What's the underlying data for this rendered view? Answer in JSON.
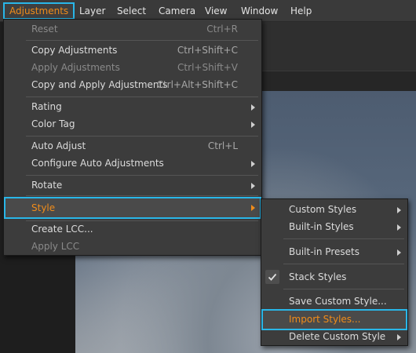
{
  "menubar": {
    "items": [
      "Adjustments",
      "Layer",
      "Select",
      "Camera",
      "View",
      "Window",
      "Help"
    ],
    "active_index": 0
  },
  "colors": {
    "accent_orange": "#f08c1a",
    "highlight_border": "#29b6e8",
    "menu_bg": "#3c3c3c"
  },
  "adjustments_menu": {
    "reset": {
      "label": "Reset",
      "shortcut": "Ctrl+R"
    },
    "copy_adjustments": {
      "label": "Copy Adjustments",
      "shortcut": "Ctrl+Shift+C"
    },
    "apply_adjustments": {
      "label": "Apply Adjustments",
      "shortcut": "Ctrl+Shift+V"
    },
    "copy_and_apply": {
      "label": "Copy and Apply Adjustments",
      "shortcut": "Ctrl+Alt+Shift+C"
    },
    "rating": {
      "label": "Rating"
    },
    "color_tag": {
      "label": "Color Tag"
    },
    "auto_adjust": {
      "label": "Auto Adjust",
      "shortcut": "Ctrl+L"
    },
    "configure_auto": {
      "label": "Configure Auto Adjustments"
    },
    "rotate": {
      "label": "Rotate"
    },
    "style": {
      "label": "Style"
    },
    "create_lcc": {
      "label": "Create LCC..."
    },
    "apply_lcc": {
      "label": "Apply LCC"
    }
  },
  "style_submenu": {
    "custom_styles": {
      "label": "Custom Styles"
    },
    "builtin_styles": {
      "label": "Built-in Styles"
    },
    "builtin_presets": {
      "label": "Built-in Presets"
    },
    "stack_styles": {
      "label": "Stack Styles",
      "checked": true
    },
    "save_custom_style": {
      "label": "Save Custom Style..."
    },
    "import_styles": {
      "label": "Import Styles..."
    },
    "delete_custom_style": {
      "label": "Delete Custom Style"
    }
  }
}
